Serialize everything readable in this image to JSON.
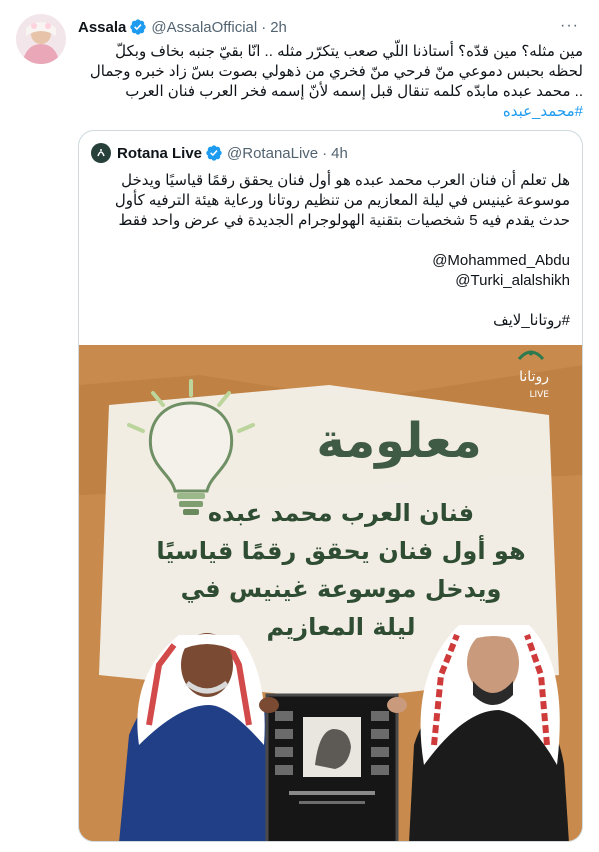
{
  "tweet": {
    "author_name": "Assala",
    "author_handle": "@AssalaOfficial",
    "separator": "·",
    "time": "2h",
    "more_label": "···",
    "lines": [
      "مين مثله؟ مين قدّه؟ أستاذنا اللّي صعب يتكرّر مثله .. انّا بقيّ جنبه بخاف وبكلّ",
      "لحظه بحبس دموعي منّ فرحي منّ فخري من ذهولي بصوت بسّ زاد خبره وجمال",
      ".. محمد عبده مابدّه كلمه تنقال قبل إسمه لأنّ إسمه فخر العرب فنان العرب"
    ],
    "hashtag": "#محمد_عبده"
  },
  "quote": {
    "author_name": "Rotana Live",
    "author_handle": "@RotanaLive",
    "separator": "·",
    "time": "4h",
    "lines": [
      "هل تعلم أن فنان العرب محمد عبده هو أول فنان يحقق رقمًا قياسيًا ويدخل",
      "موسوعة غينيس في ليلة المعازيم من تنظيم روتانا ورعاية هيئة الترفيه كأول",
      "حدث يقدم فيه 5 شخصيات بتقنية الهولوجرام الجديدة في عرض واحد فقط"
    ],
    "mentions": [
      "@Mohammed_Abdu",
      "@Turki_alalshikh"
    ],
    "hashtag": "#روتانا_لايف"
  },
  "image": {
    "logo_text": "روتانا",
    "logo_sub": "LIVE",
    "headline": "معلومة",
    "caption_lines": [
      "فنان العرب محمد عبده",
      "هو أول فنان يحقق رقمًا قياسيًا",
      "ويدخل موسوعة غينيس في",
      "ليلة المعازيم"
    ]
  },
  "colors": {
    "verified_blue": "#1d9bf0",
    "image_orange": "#c88a4d",
    "headline_green": "#3f5a45",
    "caption_green": "#2f4d33",
    "text_gray": "#536471"
  }
}
